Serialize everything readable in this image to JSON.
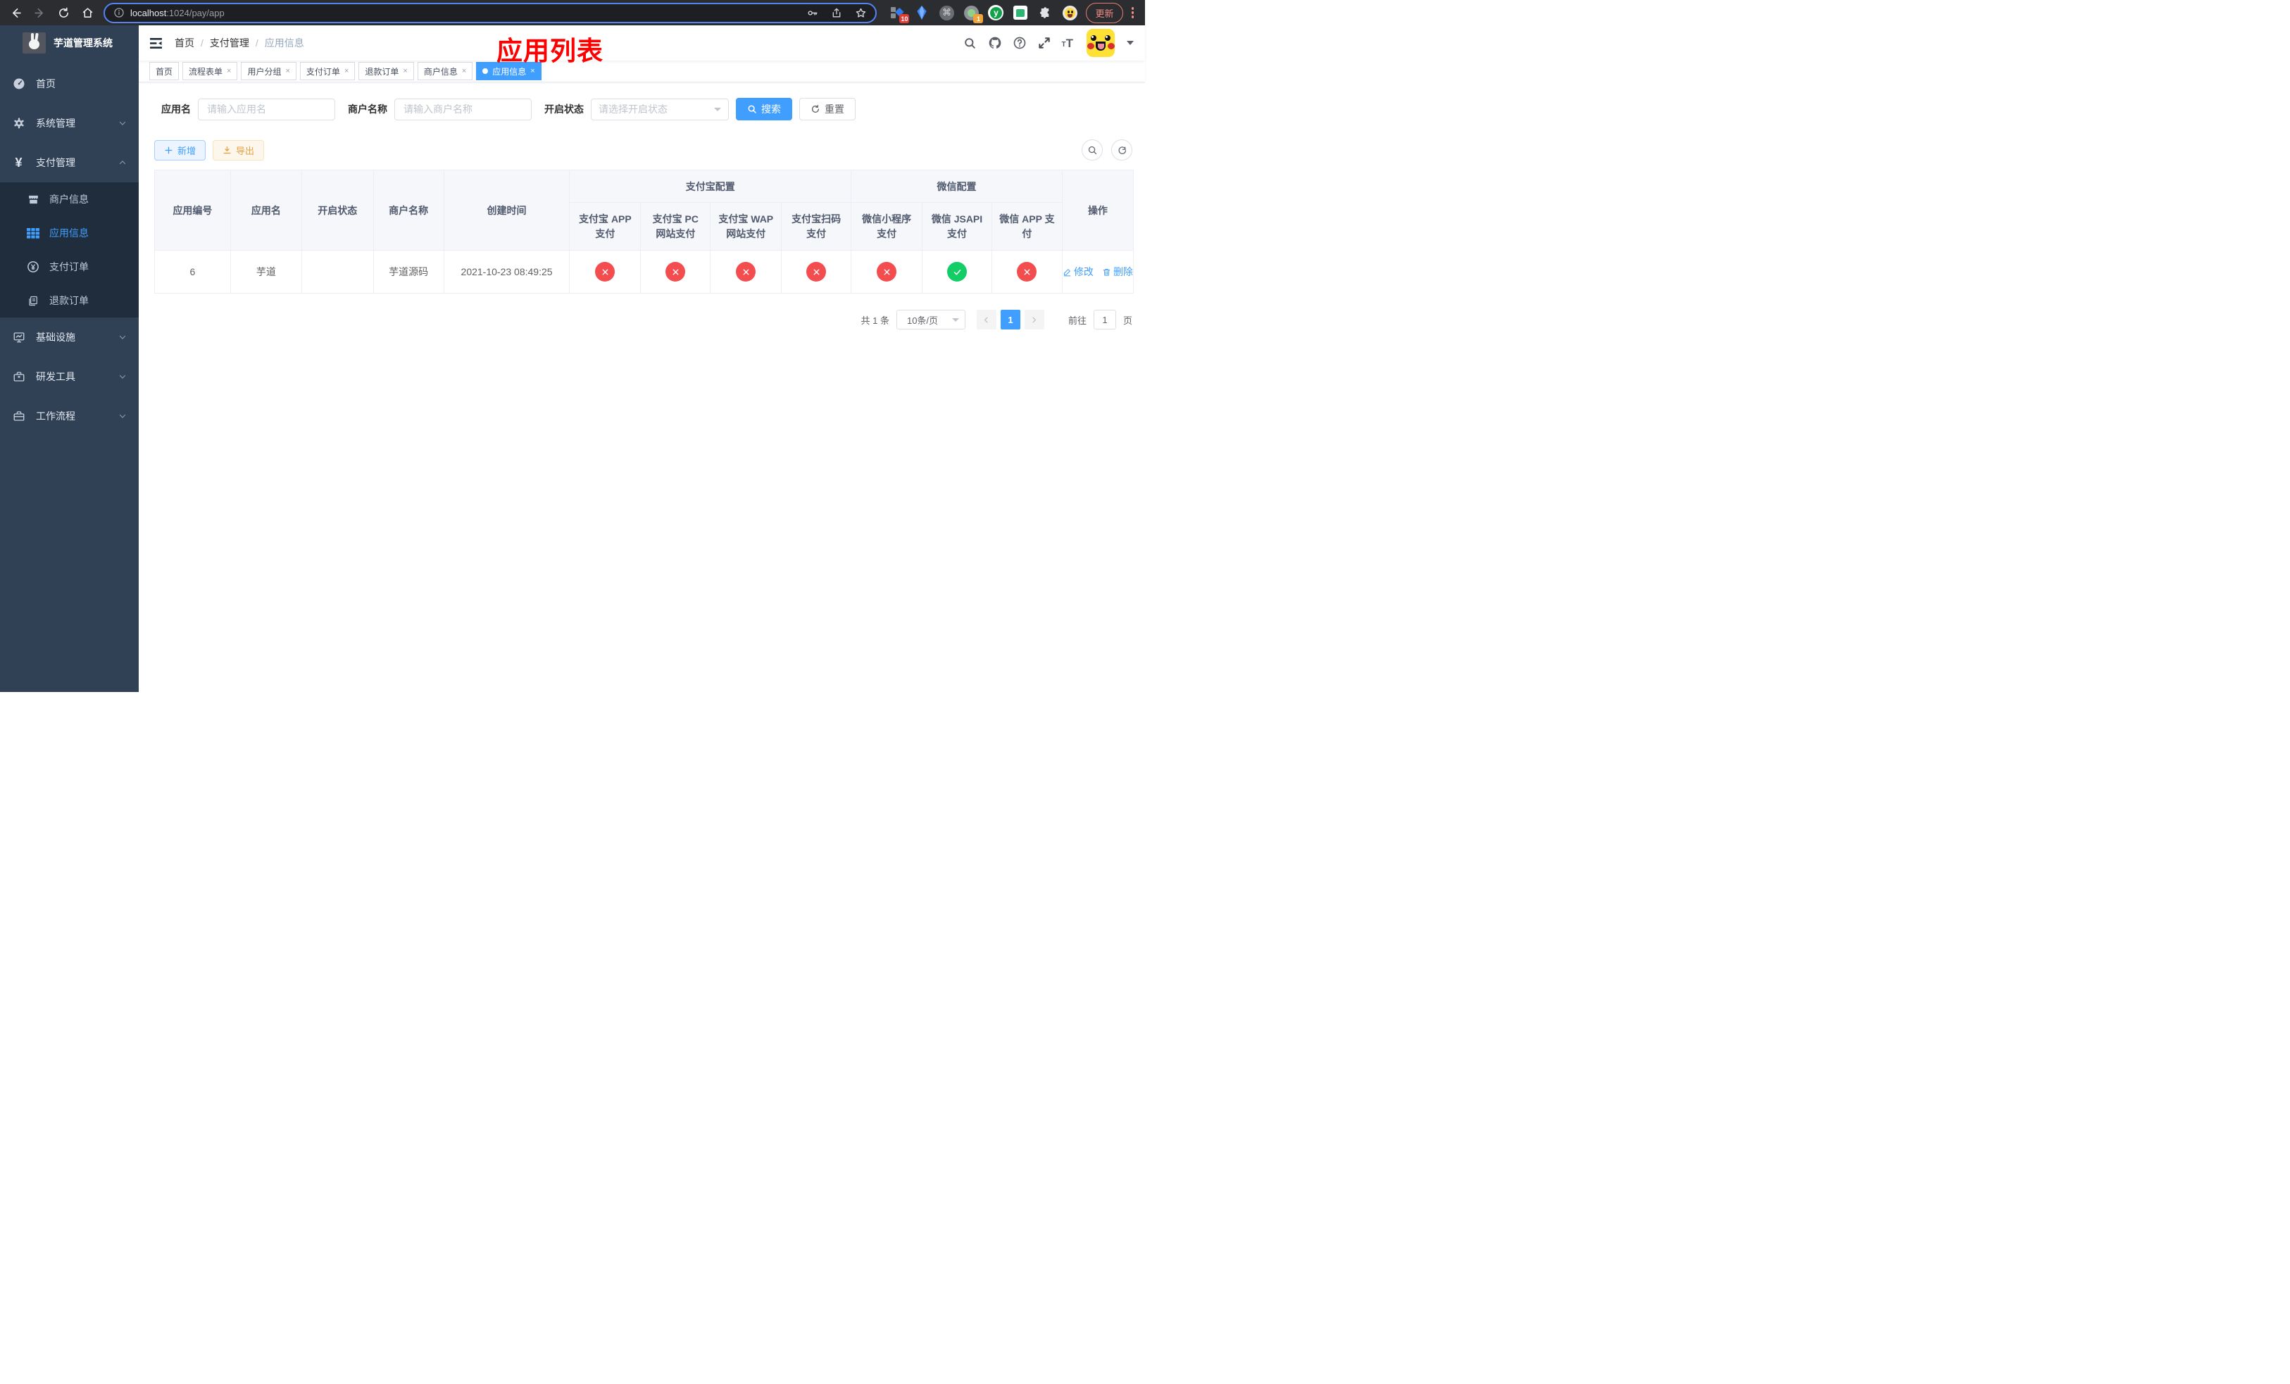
{
  "browser": {
    "url_host": "localhost",
    "url_path": ":1024/pay/app",
    "update_label": "更新",
    "ext_badge_10": "10",
    "ext_badge_1": "1",
    "ext_y_letter": "y",
    "cmd_glyph": "⌘",
    "diamond_glyph": "◆"
  },
  "sidebar": {
    "title": "芋道管理系统",
    "yen_glyph": "¥",
    "items": [
      {
        "label": "首页"
      },
      {
        "label": "系统管理"
      },
      {
        "label": "支付管理"
      },
      {
        "label": "商户信息"
      },
      {
        "label": "应用信息"
      },
      {
        "label": "支付订单"
      },
      {
        "label": "退款订单"
      },
      {
        "label": "基础设施"
      },
      {
        "label": "研发工具"
      },
      {
        "label": "工作流程"
      }
    ]
  },
  "navbar": {
    "breadcrumb": {
      "home": "首页",
      "section": "支付管理",
      "current": "应用信息",
      "sep": "/"
    },
    "overlay_title": "应用列表"
  },
  "icons": {
    "close": "×",
    "t_small": "T",
    "t_big": "T"
  },
  "tabs": [
    {
      "label": "首页",
      "closable": false,
      "active": false
    },
    {
      "label": "流程表单",
      "closable": true,
      "active": false
    },
    {
      "label": "用户分组",
      "closable": true,
      "active": false
    },
    {
      "label": "支付订单",
      "closable": true,
      "active": false
    },
    {
      "label": "退款订单",
      "closable": true,
      "active": false
    },
    {
      "label": "商户信息",
      "closable": true,
      "active": false
    },
    {
      "label": "应用信息",
      "closable": true,
      "active": true
    }
  ],
  "filters": {
    "app_name_label": "应用名",
    "app_name_placeholder": "请输入应用名",
    "merchant_label": "商户名称",
    "merchant_placeholder": "请输入商户名称",
    "status_label": "开启状态",
    "status_placeholder": "请选择开启状态",
    "search_button": "搜索",
    "reset_button": "重置"
  },
  "toolbar": {
    "add_button": "新增",
    "export_button": "导出"
  },
  "table": {
    "col_app_id": "应用编号",
    "col_app_name": "应用名",
    "col_status": "开启状态",
    "col_merchant": "商户名称",
    "col_created": "创建时间",
    "group_alipay": "支付宝配置",
    "group_wechat": "微信配置",
    "col_alipay_app": "支付宝 APP 支付",
    "col_alipay_pc": "支付宝 PC 网站支付",
    "col_alipay_wap": "支付宝 WAP 网站支付",
    "col_alipay_qr": "支付宝扫码支付",
    "col_wx_lite": "微信小程序支付",
    "col_wx_jsapi": "微信 JSAPI 支付",
    "col_wx_app": "微信 APP 支付",
    "col_actions": "操作",
    "row": {
      "app_id": "6",
      "app_name": "芋道",
      "enabled": true,
      "merchant": "芋道源码",
      "created": "2021-10-23 08:49:25",
      "alipay_app": false,
      "alipay_pc": false,
      "alipay_wap": false,
      "alipay_qr": false,
      "wx_lite": false,
      "wx_jsapi": true,
      "wx_app": false,
      "edit_label": "修改",
      "delete_label": "删除"
    }
  },
  "pagination": {
    "total": "共 1 条",
    "page_size": "10条/页",
    "current_page": "1",
    "goto_label": "前往",
    "goto_value": "1",
    "page_unit": "页"
  },
  "colors": {
    "primary": "#409eff",
    "success_circle": "#13ce66",
    "danger_circle": "#f44d4f",
    "sidebar_bg": "#304156",
    "submenu_bg": "#1f2d3d",
    "warning": "#e6a23c",
    "annotation_red": "#fd0000"
  }
}
